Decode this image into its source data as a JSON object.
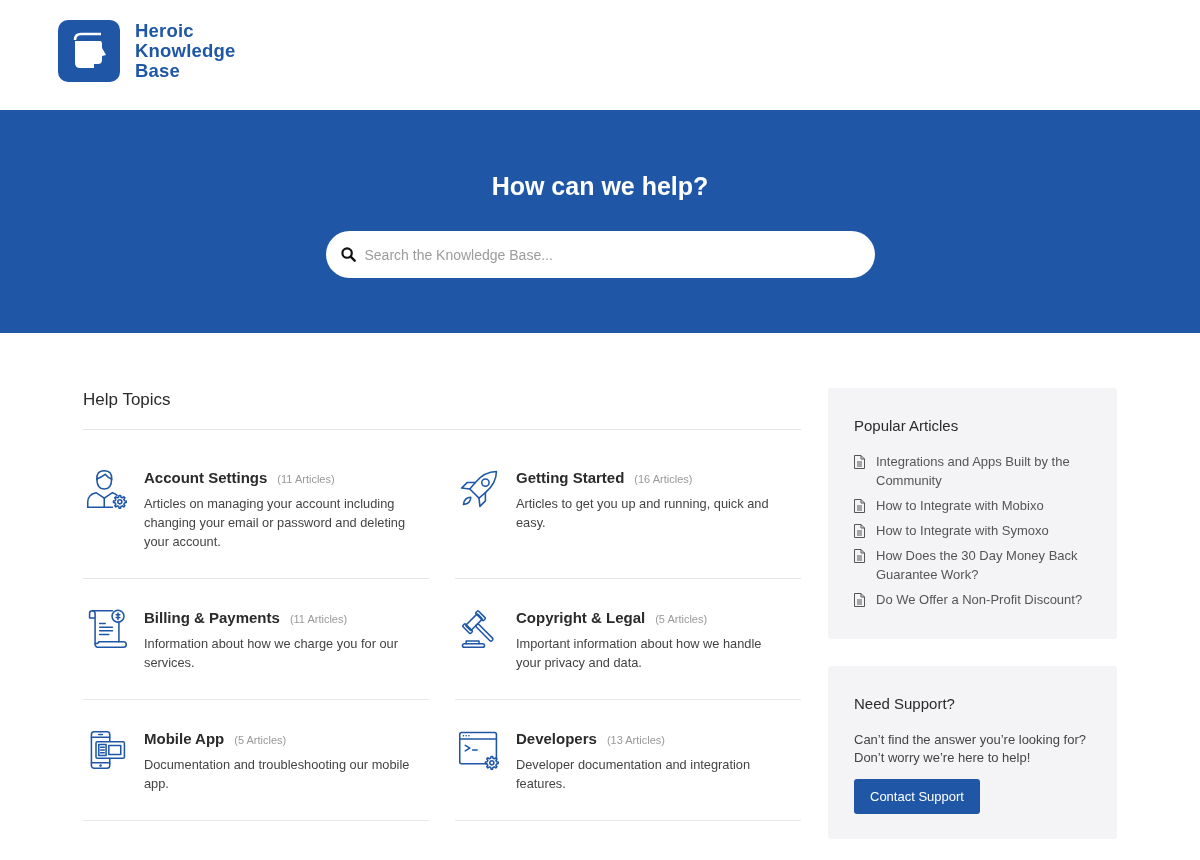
{
  "header": {
    "logo_text": "Heroic Knowledge Base"
  },
  "hero": {
    "title": "How can we help?",
    "search": {
      "placeholder": "Search the Knowledge Base..."
    }
  },
  "help_topics": {
    "title": "Help Topics",
    "topics": [
      {
        "title": "Account Settings",
        "count": "(11 Articles)",
        "description": "Articles on managing your account including changing your email or password and deleting your account."
      },
      {
        "title": "Getting Started",
        "count": "(16 Articles)",
        "description": "Articles to get you up and running, quick and easy."
      },
      {
        "title": "Billing & Payments",
        "count": "(11 Articles)",
        "description": "Information about how we charge you for our services."
      },
      {
        "title": "Copyright & Legal",
        "count": "(5 Articles)",
        "description": "Important information about how we handle your privacy and data."
      },
      {
        "title": "Mobile App",
        "count": "(5 Articles)",
        "description": "Documentation and troubleshooting our mobile app."
      },
      {
        "title": "Developers",
        "count": "(13 Articles)",
        "description": "Developer documentation and integration features."
      }
    ]
  },
  "popular_articles": {
    "title": "Popular Articles",
    "items": [
      "Integrations and Apps Built by the Community",
      "How to Integrate with Mobixo",
      "How to Integrate with Symoxo",
      "How Does the 30 Day Money Back Guarantee Work?",
      "Do We Offer a Non-Profit Discount?"
    ]
  },
  "support": {
    "title": "Need Support?",
    "text": "Can’t find the answer you’re looking for? Don’t worry we’re here to help!",
    "button": "Contact Support"
  }
}
